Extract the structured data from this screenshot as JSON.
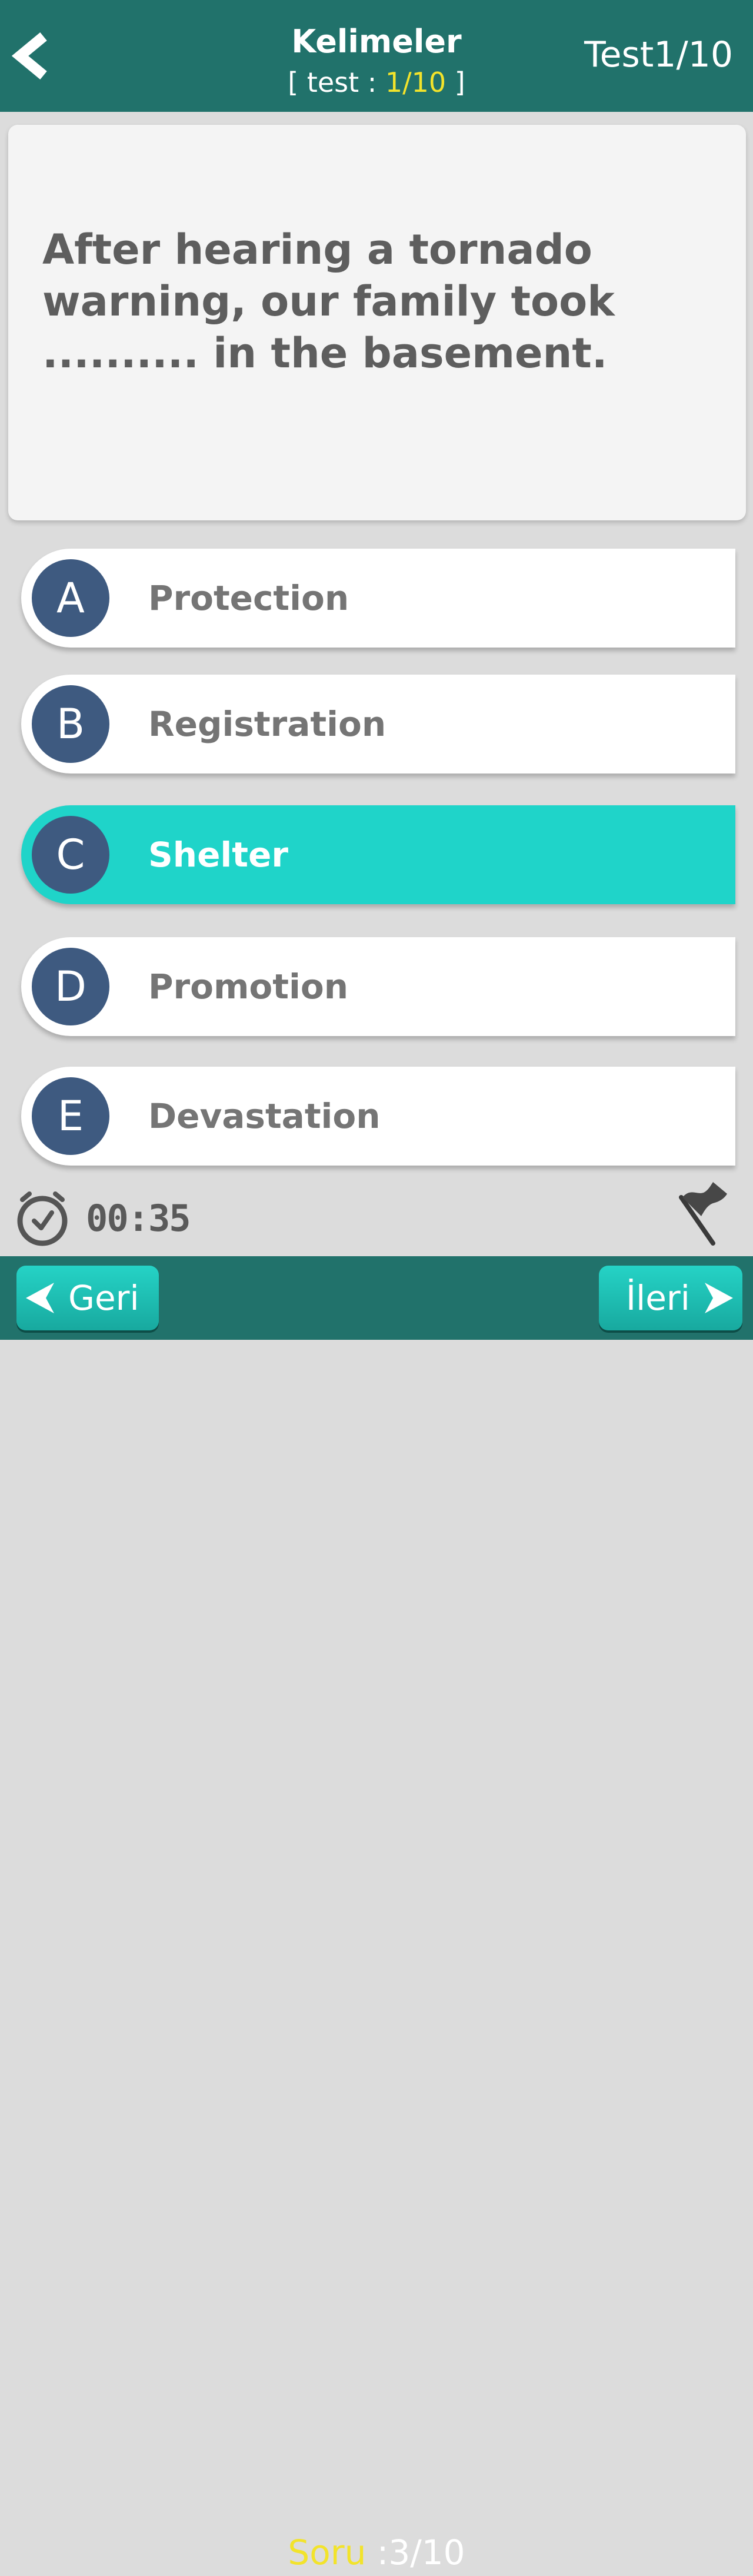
{
  "header": {
    "title": "Kelimeler",
    "subtitle_prefix": "[ test : ",
    "subtitle_value": "1/10",
    "subtitle_suffix": " ]",
    "right_label": "Test1/10",
    "back_icon": "chevron-left-icon"
  },
  "question": {
    "text": "After hearing a tornado warning, our family took .......... in the basement."
  },
  "options": [
    {
      "letter": "A",
      "label": "Protection",
      "selected": false
    },
    {
      "letter": "B",
      "label": "Registration",
      "selected": false
    },
    {
      "letter": "C",
      "label": "Shelter",
      "selected": true
    },
    {
      "letter": "D",
      "label": "Promotion",
      "selected": false
    },
    {
      "letter": "E",
      "label": "Devastation",
      "selected": false
    }
  ],
  "timer": {
    "icon": "stopwatch-icon",
    "value": "00:35"
  },
  "flag": {
    "icon": "flag-icon"
  },
  "footer": {
    "prev_label": "Geri",
    "next_label": "İleri",
    "counter_label": "Soru",
    "counter_value": " :3/10"
  },
  "colors": {
    "header_bg": "#21726b",
    "accent_yellow": "#f2e32b",
    "selected_option": "#1fd4c9",
    "letter_circle": "#3e5a80",
    "button_bg": "#25d3c6"
  }
}
